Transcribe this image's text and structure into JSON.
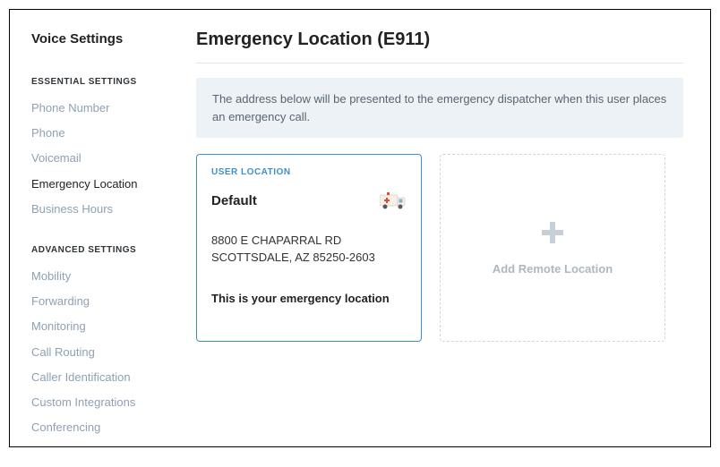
{
  "sidebar": {
    "title": "Voice Settings",
    "sections": [
      {
        "header": "ESSENTIAL SETTINGS",
        "items": [
          {
            "label": "Phone Number",
            "active": false
          },
          {
            "label": "Phone",
            "active": false
          },
          {
            "label": "Voicemail",
            "active": false
          },
          {
            "label": "Emergency Location",
            "active": true
          },
          {
            "label": "Business Hours",
            "active": false
          }
        ]
      },
      {
        "header": "ADVANCED SETTINGS",
        "items": [
          {
            "label": "Mobility",
            "active": false
          },
          {
            "label": "Forwarding",
            "active": false
          },
          {
            "label": "Monitoring",
            "active": false
          },
          {
            "label": "Call Routing",
            "active": false
          },
          {
            "label": "Caller Identification",
            "active": false
          },
          {
            "label": "Custom Integrations",
            "active": false
          },
          {
            "label": "Conferencing",
            "active": false
          }
        ]
      }
    ]
  },
  "main": {
    "title": "Emergency Location (E911)",
    "banner": "The address below will be presented to the emergency dispatcher when this user places an emergency call.",
    "location_card": {
      "label": "USER LOCATION",
      "name": "Default",
      "address": "8800 E CHAPARRAL RD\nSCOTTSDALE, AZ 85250-2603",
      "footer": "This is your emergency location"
    },
    "add_card": {
      "label": "Add Remote Location"
    }
  }
}
